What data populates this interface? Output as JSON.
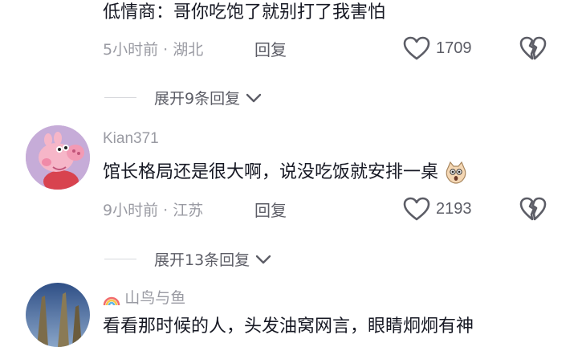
{
  "comments": [
    {
      "text": "低情商：哥你吃饱了就别打了我害怕",
      "meta": "5小时前 · 湖北",
      "reply_label": "回复",
      "likes": "1709",
      "expand_label": "展开9条回复"
    },
    {
      "username": "Kian371",
      "avatar": "peppa-pig-avatar",
      "text": "馆长格局还是很大啊，说没吃饭就安排一桌",
      "emoji": "surprised-dog-emoji",
      "meta": "9小时前 · 江苏",
      "reply_label": "回复",
      "likes": "2193",
      "expand_label": "展开13条回复"
    },
    {
      "username_prefix_emoji": "rainbow-icon",
      "username": "山鸟与鱼",
      "avatar": "landscape-avatar",
      "text": "看看那时候的人，头发油窝网言，眼睛炯炯有神"
    }
  ],
  "colors": {
    "text_primary": "#161823",
    "text_secondary": "#9a9ba3",
    "action": "#5c5d66"
  }
}
